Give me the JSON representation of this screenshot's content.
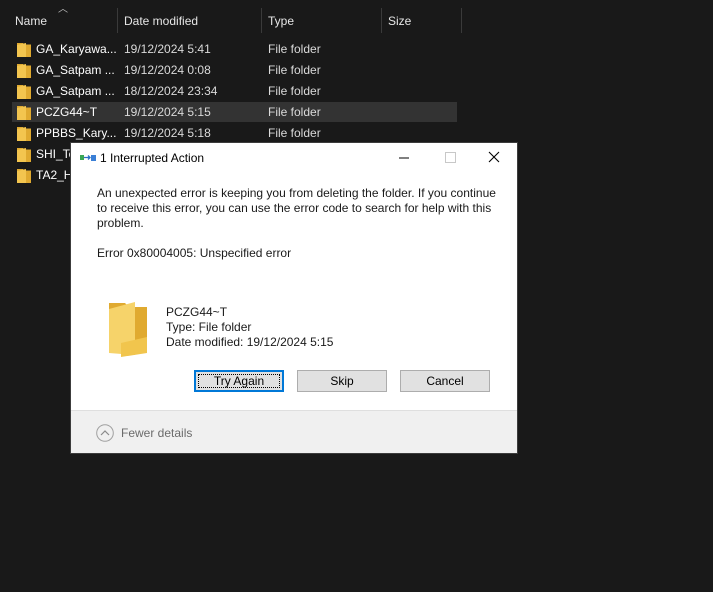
{
  "explorer": {
    "columns": {
      "name": "Name",
      "date_modified": "Date modified",
      "type": "Type",
      "size": "Size"
    },
    "rows": [
      {
        "name": "GA_Karyawa...",
        "date": "19/12/2024 5:41",
        "type": "File folder",
        "selected": false
      },
      {
        "name": "GA_Satpam ...",
        "date": "19/12/2024 0:08",
        "type": "File folder",
        "selected": false
      },
      {
        "name": "GA_Satpam ...",
        "date": "18/12/2024 23:34",
        "type": "File folder",
        "selected": false
      },
      {
        "name": "PCZG44~T",
        "date": "19/12/2024 5:15",
        "type": "File folder",
        "selected": true
      },
      {
        "name": "PPBBS_Kary...",
        "date": "19/12/2024 5:18",
        "type": "File folder",
        "selected": false
      },
      {
        "name": "SHI_Te",
        "date": "",
        "type": "",
        "selected": false
      },
      {
        "name": "TA2_H",
        "date": "",
        "type": "",
        "selected": false
      }
    ]
  },
  "dialog": {
    "title": "1 Interrupted Action",
    "message": "An unexpected error is keeping you from deleting the folder. If you continue to receive this error, you can use the error code to search for help with this problem.",
    "error": "Error 0x80004005: Unspecified error",
    "item": {
      "name": "PCZG44~T",
      "type": "Type: File folder",
      "date": "Date modified: 19/12/2024 5:15"
    },
    "buttons": {
      "try_again": "Try Again",
      "skip": "Skip",
      "cancel": "Cancel"
    },
    "fewer_details": "Fewer details"
  },
  "colors": {
    "background": "#191919",
    "selected_row": "#333333",
    "folder": "#f3c54f",
    "accent": "#0078d7"
  }
}
